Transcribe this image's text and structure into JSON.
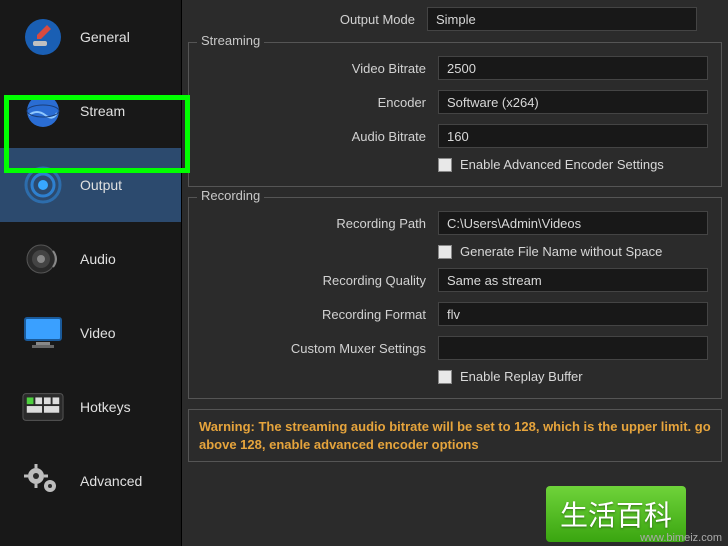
{
  "sidebar": {
    "items": [
      {
        "label": "General"
      },
      {
        "label": "Stream"
      },
      {
        "label": "Output"
      },
      {
        "label": "Audio"
      },
      {
        "label": "Video"
      },
      {
        "label": "Hotkeys"
      },
      {
        "label": "Advanced"
      }
    ]
  },
  "output_mode": {
    "label": "Output Mode",
    "value": "Simple"
  },
  "streaming": {
    "legend": "Streaming",
    "video_bitrate": {
      "label": "Video Bitrate",
      "value": "2500"
    },
    "encoder": {
      "label": "Encoder",
      "value": "Software (x264)"
    },
    "audio_bitrate": {
      "label": "Audio Bitrate",
      "value": "160"
    },
    "advanced_cb": "Enable Advanced Encoder Settings"
  },
  "recording": {
    "legend": "Recording",
    "path": {
      "label": "Recording Path",
      "value": "C:\\Users\\Admin\\Videos"
    },
    "gen_filename_cb": "Generate File Name without Space",
    "quality": {
      "label": "Recording Quality",
      "value": "Same as stream"
    },
    "format": {
      "label": "Recording Format",
      "value": "flv"
    },
    "muxer": {
      "label": "Custom Muxer Settings",
      "value": ""
    },
    "replay_cb": "Enable Replay Buffer"
  },
  "warning": "Warning: The streaming audio bitrate will be set to 128, which is the upper limit. go above 128, enable advanced encoder options",
  "watermark": "www.bimeiz.com",
  "stamp": "生活百科"
}
